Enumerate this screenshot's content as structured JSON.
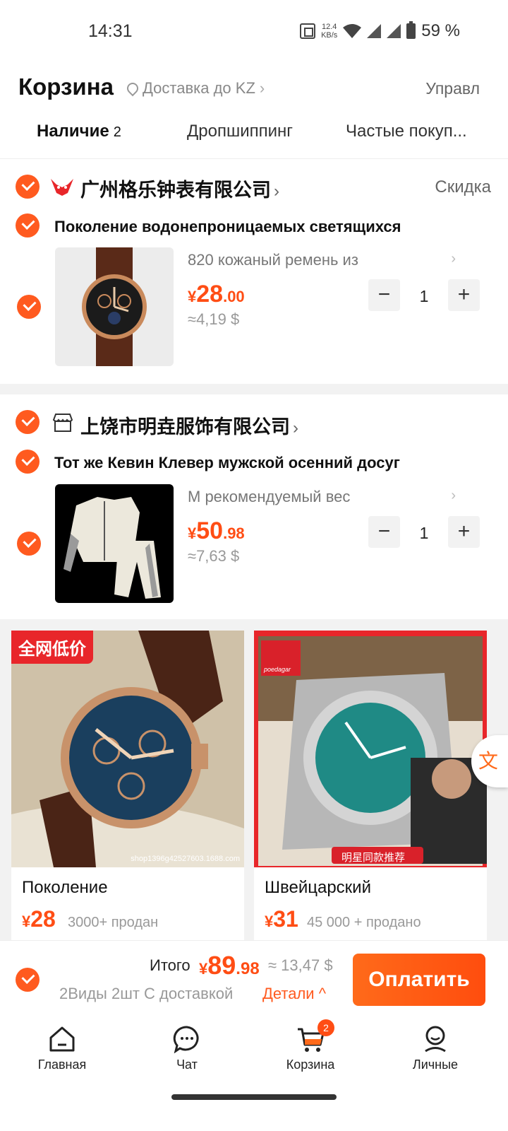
{
  "status_bar": {
    "time": "14:31",
    "speed_value": "12.4",
    "speed_unit": "KB/s",
    "battery": "59 %"
  },
  "header": {
    "title": "Корзина",
    "delivery": "Доставка до KZ",
    "manage": "Управл",
    "tabs": [
      {
        "label": "Наличие",
        "count": "2"
      },
      {
        "label": "Дропшиппинг"
      },
      {
        "label": "Частые покуп..."
      }
    ]
  },
  "shops": [
    {
      "name": "广州格乐钟表有限公司",
      "discount_label": "Скидка",
      "product": {
        "title": "Поколение водонепроницаемых светящихся",
        "variant": "820 кожаный ремень из",
        "price_currency": "¥",
        "price_int": "28",
        "price_dec": ".00",
        "approx": "≈4,19 $",
        "quantity": "1"
      }
    },
    {
      "name": "上饶市明垚服饰有限公司",
      "product": {
        "title": "Тот же Кевин Клевер мужской осенний досуг",
        "variant": "M рекомендуемый вес",
        "price_currency": "¥",
        "price_int": "50",
        "price_dec": ".98",
        "approx": "≈7,63 $",
        "quantity": "1"
      }
    }
  ],
  "recommendations": [
    {
      "badge": "全网低价",
      "watermark": "shop1396g42527603.1688.com",
      "name": "Поколение",
      "price_currency": "¥",
      "price": "28",
      "sold": "3000+ продан"
    },
    {
      "badge": "明星同款推荐",
      "brand": "poedagar",
      "name": "Швейцарский",
      "price_currency": "¥",
      "price": "31",
      "sold": "45 000 + продано"
    }
  ],
  "total": {
    "label": "Итого",
    "currency": "¥",
    "int": "89",
    "dec": ".98",
    "approx": "≈ 13,47 $",
    "summary": "2Виды 2шт  С доставкой",
    "details": "Детали ^",
    "pay_label": "Оплатить"
  },
  "nav": [
    {
      "label": "Главная",
      "icon": "home-icon"
    },
    {
      "label": "Чат",
      "icon": "chat-icon"
    },
    {
      "label": "Корзина",
      "icon": "cart-icon",
      "badge": "2"
    },
    {
      "label": "Личные",
      "icon": "profile-icon"
    }
  ],
  "colors": {
    "accent": "#ff4d14",
    "check": "#ff5a1f",
    "badge_red": "#e8262a"
  }
}
